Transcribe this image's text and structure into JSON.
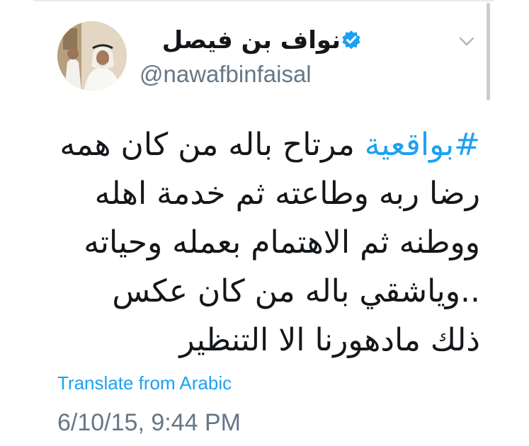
{
  "tweet": {
    "author": {
      "display_name": "نواف بن فيصل",
      "handle": "@nawafbinfaisal",
      "verified": true,
      "avatar_icon": "profile-photo"
    },
    "body": {
      "hashtag": "#بواقعية",
      "text": " مرتاح باله من كان همه رضا ربه وطاعته ثم خدمة اهله ووطنه ثم الاهتمام بعمله وحياته ..وياشقي باله من كان عكس ذلك مادهورنا الا التنظير"
    },
    "translate_label": "Translate from Arabic",
    "timestamp": "6/10/15, 9:44 PM",
    "menu_icon": "chevron-down-icon"
  },
  "colors": {
    "link": "#1da1f2",
    "secondary_text": "#657786",
    "primary_text": "#14171a",
    "verified_badge": "#1da1f2"
  }
}
